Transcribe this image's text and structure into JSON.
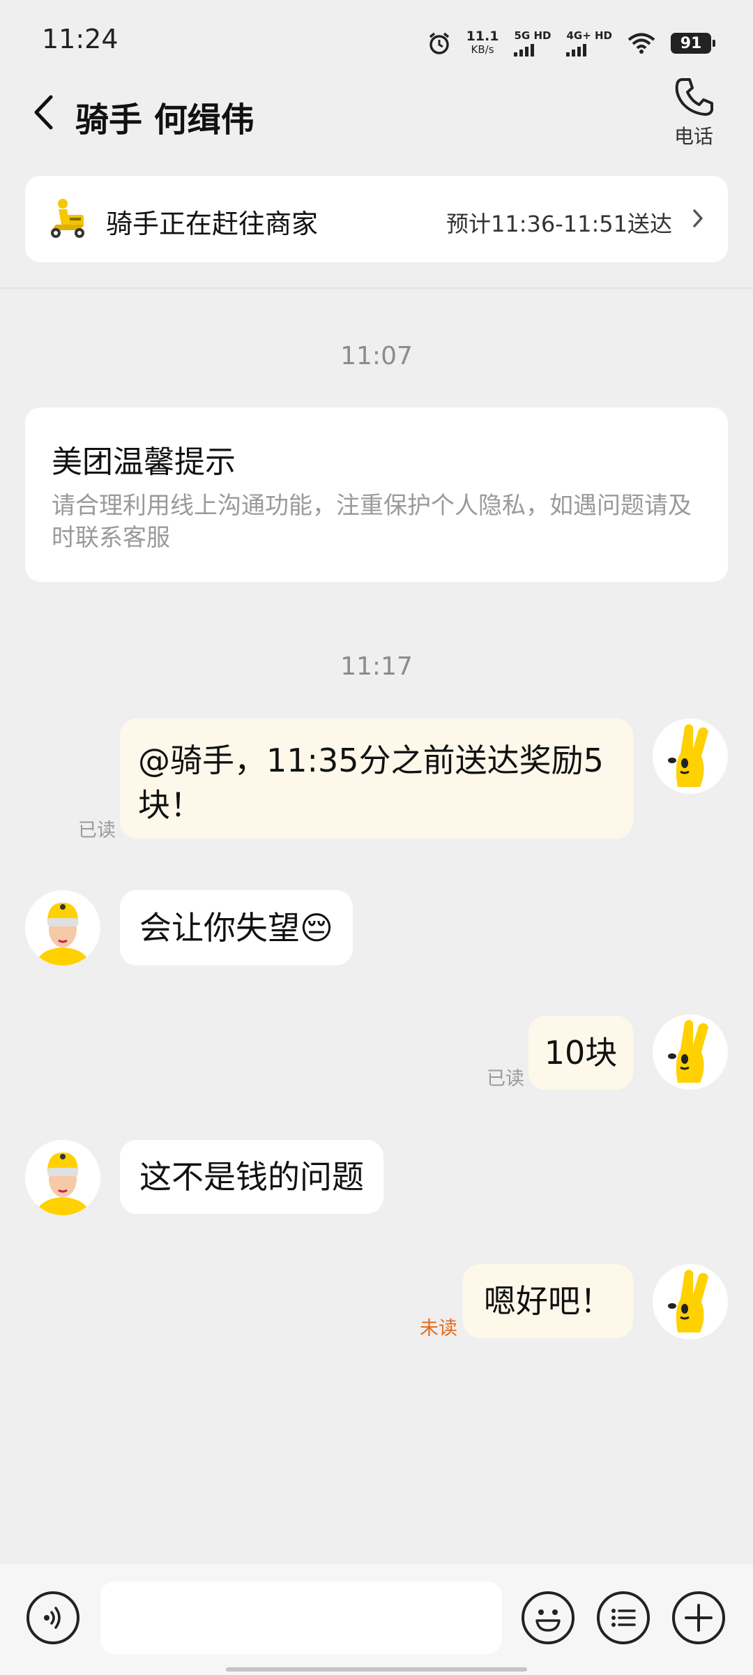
{
  "status_bar": {
    "time": "11:24",
    "net_speed_value": "11.1",
    "net_speed_unit": "KB/s",
    "sim1_label": "5G HD",
    "sim2_label": "4G+ HD",
    "battery": "91",
    "icons": [
      "alarm-icon",
      "signal-icon",
      "signal-icon",
      "wifi-icon",
      "battery-icon"
    ]
  },
  "header": {
    "title": "骑手 何缉伟",
    "phone_label": "电话"
  },
  "delivery": {
    "status": "骑手正在赶往商家",
    "eta": "预计11:36-11:51送达"
  },
  "timestamps": [
    "11:07",
    "11:17"
  ],
  "notice": {
    "title": "美团温馨提示",
    "body": "请合理利用线上沟通功能，注重保护个人隐私，如遇问题请及时联系客服"
  },
  "messages": [
    {
      "from": "me",
      "text_line1": "@骑手，11:35分之前送达奖励5",
      "text_line2": "块！",
      "status": "已读"
    },
    {
      "from": "rider",
      "text": "会让你失望😔"
    },
    {
      "from": "me",
      "text": "10块",
      "status": "已读"
    },
    {
      "from": "rider",
      "text": "这不是钱的问题"
    },
    {
      "from": "me",
      "text": "嗯好吧！",
      "status": "未读"
    }
  ],
  "colors": {
    "brand_yellow": "#ffd100",
    "unread_orange": "#e46a1a",
    "bubble_out": "#fdf8ea",
    "background": "#efefef"
  },
  "input": {
    "value": "",
    "placeholder": ""
  }
}
